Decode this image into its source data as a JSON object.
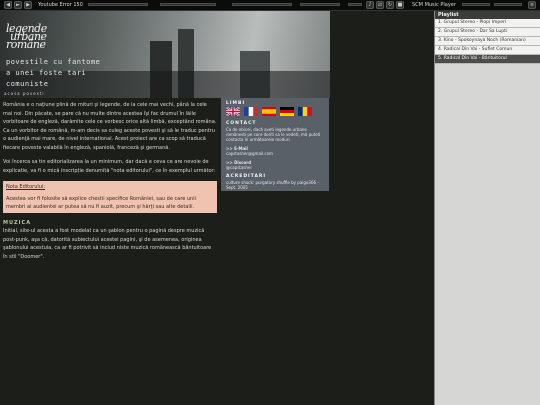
{
  "player": {
    "track_title": "Youtube Error 150",
    "app_name": "SCM Music Player",
    "icons": [
      "prev-icon",
      "play-icon",
      "next-icon",
      "volume-icon",
      "menu-icon"
    ],
    "progress": 0.0
  },
  "banner": {
    "logo_lines": [
      "legende",
      "urbane",
      "române"
    ],
    "tagline_1": "povestile cu fantome",
    "tagline_2": "a unei foste tari",
    "tagline_3": "comuniste",
    "nav": "acasa    povesti"
  },
  "content": {
    "intro": "România e o naţiune plină de mituri şi legende, de la cele mai vechi, până la cele mai noi. Din păcate, se pare că nu multe dintre acestea îşi fac drumul în lăile vorbitoare de engleză, darămite cele ce vorbesc orice altă limbă, exceptând româna. Ca un vorbitor de română, m-am decis sa culeg aceste povesti şi să le traduc pentru o audienţă mai mare, de nivel international. Acest proiect are ca scop să traducă fiecare poveste valabilă în engleză, spaniolă, franceză şi germană.",
    "para2": "Voi încerca sa tin editorializarea la un minimum, dar dacă e ceva ce are nevoie de explicatie, va fi o mică inscripție denumită \"nota editorului\", ce în exemplul următor:",
    "note_title": "Nota Editorului:",
    "note_body": "Acestea vor fi folosite să explice chestii specifice României, sau de care unii membri ai audientei ar putea să nu fi auzit, precum şi hărţi sau alte detalii.",
    "music_heading": "MUZICA",
    "music_body": "Initial, site-ul acesta a fost modelat ca un şablon pentru o pagină despre muzică post-punk, aşa că, datorită subiectului acestei pagini, şi de asemenea, originea şablonului acestuia, ca ar fi potrivit să includ niste muzică românească bântuitoare în stil \"Doomer\"."
  },
  "sidebar": {
    "lang_heading": "LIMBI",
    "flags": [
      "uk-flag",
      "france-flag",
      "spain-flag",
      "germany-flag",
      "romania-flag"
    ],
    "contact_heading": "CONTACT",
    "contact_body": "Ca de obicei, dacă aveti legende urbane românesti pe care doriti sa le vedeti, mă puteti contacta în următoarele moduri",
    "email_label": ">> E-Mail",
    "email_value": "capstasher@gmail.com",
    "discord_label": ">> Discord",
    "discord_value": "@capstasher",
    "credits_heading": "ACREDITARI",
    "credits_body": "culture shock: purgatory shuffle by paige366 - Sept. 2005"
  },
  "playlist": {
    "title": "Playlist",
    "items": [
      "1. Grupul Stereo - Plopi Imperi",
      "2. Grupul Stereo - Dar Sa Lupti",
      "3. Kino - Spokoynaya Noch (Romanian)",
      "4. Radical Din Vai - Suflet Comun",
      "5. Radical Din Vai - Bântuitorul"
    ],
    "active_index": 4
  },
  "colors": {
    "page_bg": "#1b1e19",
    "note_bg": "#f0c2b0",
    "sidebar_bg": "#5a6068",
    "playlist_active": "#4a4d4a"
  }
}
